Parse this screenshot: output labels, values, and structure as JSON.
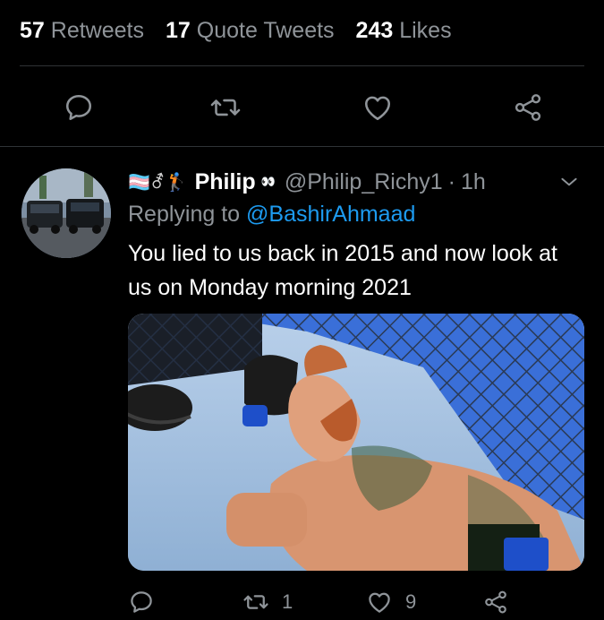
{
  "stats": [
    {
      "count": "57",
      "label": "Retweets"
    },
    {
      "count": "17",
      "label": "Quote Tweets"
    },
    {
      "count": "243",
      "label": "Likes"
    }
  ],
  "actions": {
    "reply_icon": "reply-icon",
    "retweet_icon": "retweet-icon",
    "like_icon": "heart-icon",
    "share_icon": "share-icon"
  },
  "reply_tweet": {
    "emoji_prefix": "🏳️‍⚧️⚦🏌️",
    "display_name": "Philip",
    "name_emoji": "👀",
    "handle": "@Philip_Richy1",
    "separator": "·",
    "time": "1h",
    "replying_prefix": "Replying to",
    "replying_to": "@BashirAhmaad",
    "text": "You lied to us back in 2015 and now look at us on Monday morning 2021",
    "media_description_icon": "photo",
    "reply_count": "",
    "retweet_count": "1",
    "like_count": "9",
    "share_count": ""
  },
  "colors": {
    "background": "#000000",
    "text_primary": "#ffffff",
    "text_secondary": "#8f9499",
    "link": "#1d9bf0",
    "divider": "#2f3336"
  }
}
